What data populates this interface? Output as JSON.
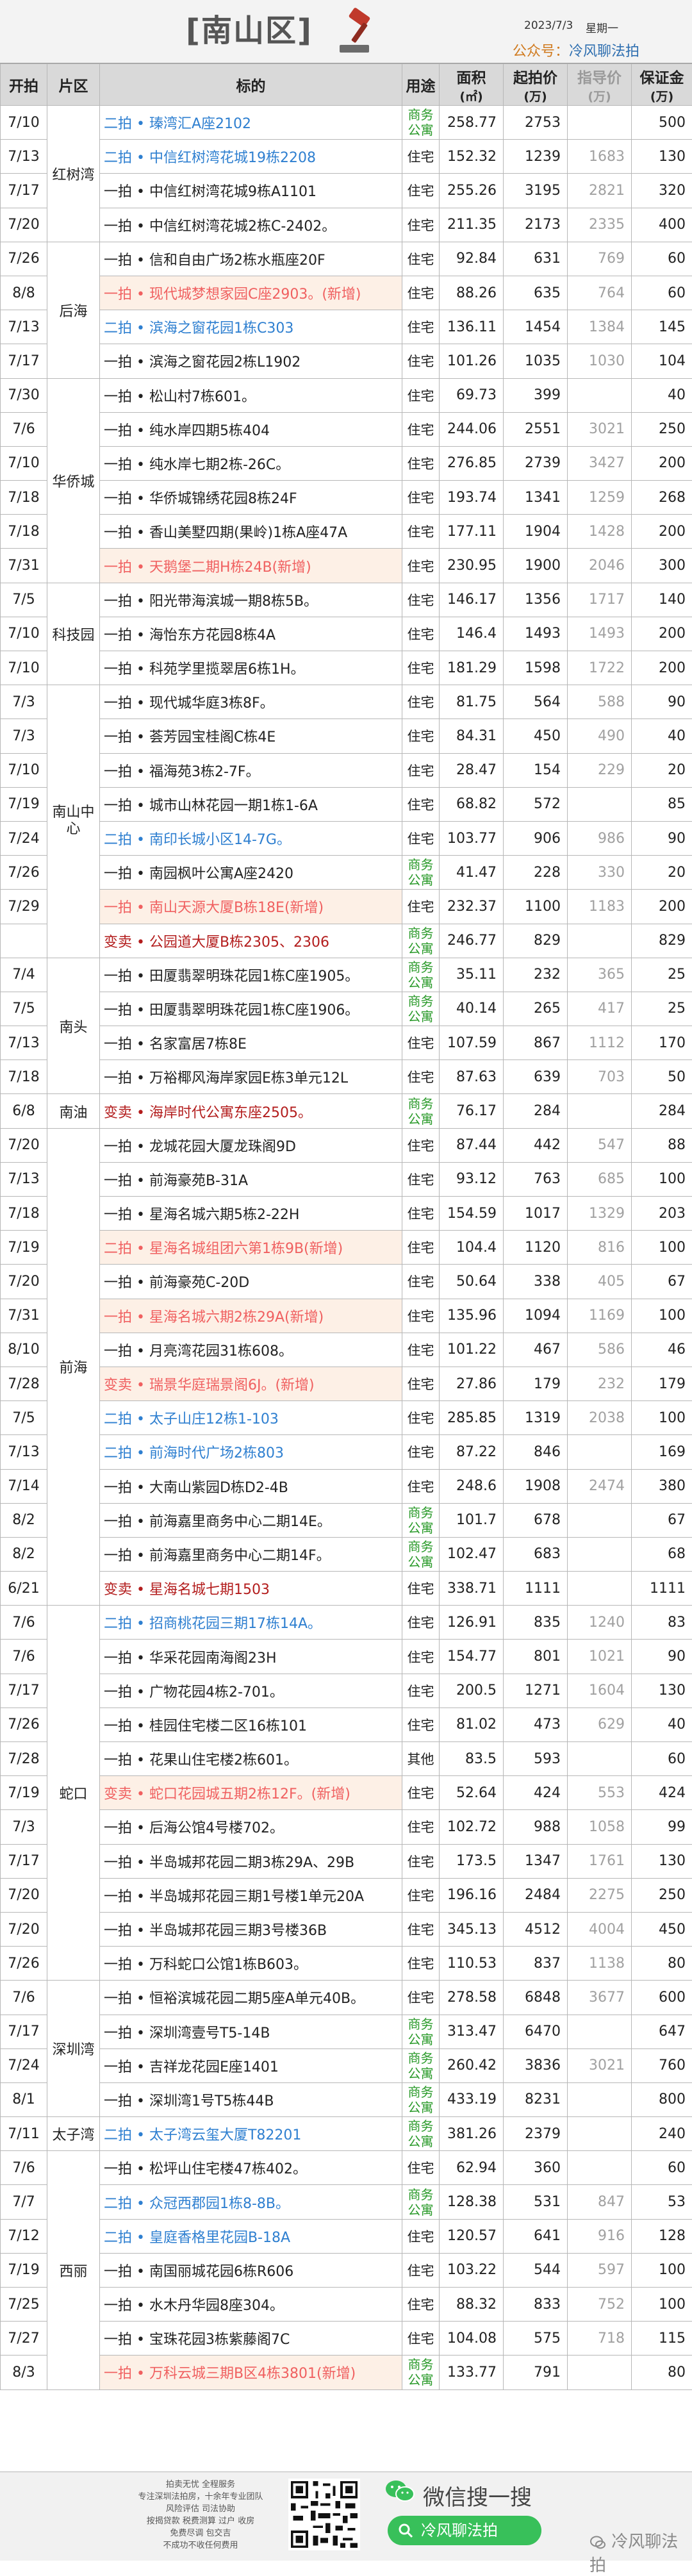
{
  "header": {
    "title": "[南山区]",
    "date": "2023/7/3",
    "weekday": "星期一",
    "publisher_label": "公众号：",
    "publisher_name": "冷风聊法拍"
  },
  "columns": {
    "date": "开拍",
    "area": "片区",
    "target": "标的",
    "usage": "用途",
    "size_top": "面积",
    "size_unit": "(㎡)",
    "start_top": "起拍价",
    "start_unit": "(万)",
    "ref_top": "指导价",
    "ref_unit": "(万)",
    "deposit_top": "保证金",
    "deposit_unit": "(万)"
  },
  "areas": [
    {
      "name": "红树湾",
      "span": 4
    },
    {
      "name": "后海",
      "span": 4
    },
    {
      "name": "华侨城",
      "span": 6
    },
    {
      "name": "科技园",
      "span": 3
    },
    {
      "name": "南山中心",
      "span": 8
    },
    {
      "name": "南头",
      "span": 4
    },
    {
      "name": "南油",
      "span": 1
    },
    {
      "name": "前海",
      "span": 14
    },
    {
      "name": "蛇口",
      "span": 11
    },
    {
      "name": "深圳湾",
      "span": 4
    },
    {
      "name": "太子湾",
      "span": 1
    },
    {
      "name": "西丽",
      "span": 8
    }
  ],
  "rows": [
    {
      "date": "7/10",
      "title": "二拍 • 瑧湾汇A座2102",
      "usage": "商务公寓",
      "area": "258.77",
      "start": "2753",
      "ref": "",
      "deposit": "500",
      "kind": "r"
    },
    {
      "date": "7/13",
      "title": "二拍 • 中信红树湾花城19栋2208",
      "usage": "住宅",
      "area": "152.32",
      "start": "1239",
      "ref": "1683",
      "deposit": "130",
      "kind": "r"
    },
    {
      "date": "7/17",
      "title": "一拍 • 中信红树湾花城9栋A1101",
      "usage": "住宅",
      "area": "255.26",
      "start": "3195",
      "ref": "2821",
      "deposit": "320",
      "kind": ""
    },
    {
      "date": "7/20",
      "title": "一拍 • 中信红树湾花城2栋C-2402。",
      "usage": "住宅",
      "area": "211.35",
      "start": "2173",
      "ref": "2335",
      "deposit": "400",
      "kind": ""
    },
    {
      "date": "7/26",
      "title": "一拍 • 信和自由广场2栋水瓶座20F",
      "usage": "住宅",
      "area": "92.84",
      "start": "631",
      "ref": "769",
      "deposit": "60",
      "kind": ""
    },
    {
      "date": "8/8",
      "title": "一拍 • 现代城梦想家园C座2903。(新增)",
      "usage": "住宅",
      "area": "88.26",
      "start": "635",
      "ref": "764",
      "deposit": "60",
      "kind": "p"
    },
    {
      "date": "7/13",
      "title": "二拍 • 滨海之窗花园1栋C303",
      "usage": "住宅",
      "area": "136.11",
      "start": "1454",
      "ref": "1384",
      "deposit": "145",
      "kind": "r"
    },
    {
      "date": "7/17",
      "title": "一拍 • 滨海之窗花园2栋L1902",
      "usage": "住宅",
      "area": "101.26",
      "start": "1035",
      "ref": "1030",
      "deposit": "104",
      "kind": ""
    },
    {
      "date": "7/30",
      "title": "一拍 • 松山村7栋601。",
      "usage": "住宅",
      "area": "69.73",
      "start": "399",
      "ref": "",
      "deposit": "40",
      "kind": ""
    },
    {
      "date": "7/6",
      "title": "一拍 • 纯水岸四期5栋404",
      "usage": "住宅",
      "area": "244.06",
      "start": "2551",
      "ref": "3021",
      "deposit": "250",
      "kind": ""
    },
    {
      "date": "7/10",
      "title": "一拍 • 纯水岸七期2栋-26C。",
      "usage": "住宅",
      "area": "276.85",
      "start": "2739",
      "ref": "3427",
      "deposit": "200",
      "kind": ""
    },
    {
      "date": "7/18",
      "title": "一拍 • 华侨城锦绣花园8栋24F",
      "usage": "住宅",
      "area": "193.74",
      "start": "1341",
      "ref": "1259",
      "deposit": "268",
      "kind": ""
    },
    {
      "date": "7/18",
      "title": "一拍 • 香山美墅四期(果岭)1栋A座47A",
      "usage": "住宅",
      "area": "177.11",
      "start": "1904",
      "ref": "1428",
      "deposit": "200",
      "kind": ""
    },
    {
      "date": "7/31",
      "title": "一拍 • 天鹅堡二期H栋24B(新增)",
      "usage": "住宅",
      "area": "230.95",
      "start": "1900",
      "ref": "2046",
      "deposit": "300",
      "kind": "p"
    },
    {
      "date": "7/5",
      "title": "一拍 • 阳光带海滨城一期8栋5B。",
      "usage": "住宅",
      "area": "146.17",
      "start": "1356",
      "ref": "1717",
      "deposit": "140",
      "kind": ""
    },
    {
      "date": "7/10",
      "title": "一拍 • 海怡东方花园8栋4A",
      "usage": "住宅",
      "area": "146.4",
      "start": "1493",
      "ref": "1493",
      "deposit": "200",
      "kind": ""
    },
    {
      "date": "7/10",
      "title": "一拍 • 科苑学里揽翠居6栋1H。",
      "usage": "住宅",
      "area": "181.29",
      "start": "1598",
      "ref": "1722",
      "deposit": "200",
      "kind": ""
    },
    {
      "date": "7/3",
      "title": "一拍 • 现代城华庭3栋8F。",
      "usage": "住宅",
      "area": "81.75",
      "start": "564",
      "ref": "588",
      "deposit": "90",
      "kind": ""
    },
    {
      "date": "7/3",
      "title": "一拍 • 荟芳园宝桂阁C栋4E",
      "usage": "住宅",
      "area": "84.31",
      "start": "450",
      "ref": "490",
      "deposit": "40",
      "kind": ""
    },
    {
      "date": "7/10",
      "title": "一拍 • 福海苑3栋2-7F。",
      "usage": "住宅",
      "area": "28.47",
      "start": "154",
      "ref": "229",
      "deposit": "20",
      "kind": ""
    },
    {
      "date": "7/19",
      "title": "一拍 • 城市山林花园一期1栋1-6A",
      "usage": "住宅",
      "area": "68.82",
      "start": "572",
      "ref": "",
      "deposit": "85",
      "kind": ""
    },
    {
      "date": "7/24",
      "title": "二拍 • 南印长城小区14-7G。",
      "usage": "住宅",
      "area": "103.77",
      "start": "906",
      "ref": "986",
      "deposit": "90",
      "kind": "r"
    },
    {
      "date": "7/26",
      "title": "一拍 • 南园枫叶公寓A座2420",
      "usage": "商务公寓",
      "area": "41.47",
      "start": "228",
      "ref": "330",
      "deposit": "20",
      "kind": ""
    },
    {
      "date": "7/29",
      "title": "一拍 • 南山天源大厦B栋18E(新增)",
      "usage": "住宅",
      "area": "232.37",
      "start": "1100",
      "ref": "1183",
      "deposit": "200",
      "kind": "p"
    },
    {
      "date": "",
      "title": "变卖 • 公园道大厦B栋2305、2306",
      "usage": "商务公寓",
      "area": "246.77",
      "start": "829",
      "ref": "",
      "deposit": "829",
      "kind": "s"
    },
    {
      "date": "7/4",
      "title": "一拍 • 田厦翡翠明珠花园1栋C座1905。",
      "usage": "商务公寓",
      "area": "35.11",
      "start": "232",
      "ref": "365",
      "deposit": "25",
      "kind": ""
    },
    {
      "date": "7/5",
      "title": "一拍 • 田厦翡翠明珠花园1栋C座1906。",
      "usage": "商务公寓",
      "area": "40.14",
      "start": "265",
      "ref": "417",
      "deposit": "25",
      "kind": ""
    },
    {
      "date": "7/13",
      "title": "一拍 • 名家富居7栋8E",
      "usage": "住宅",
      "area": "107.59",
      "start": "867",
      "ref": "1112",
      "deposit": "170",
      "kind": ""
    },
    {
      "date": "7/18",
      "title": "一拍 • 万裕椰风海岸家园E栋3单元12L",
      "usage": "住宅",
      "area": "87.63",
      "start": "639",
      "ref": "703",
      "deposit": "50",
      "kind": ""
    },
    {
      "date": "6/8",
      "title": "变卖 • 海岸时代公寓东座2505。",
      "usage": "商务公寓",
      "area": "76.17",
      "start": "284",
      "ref": "",
      "deposit": "284",
      "kind": "s"
    },
    {
      "date": "7/20",
      "title": "一拍 • 龙城花园大厦龙珠阁9D",
      "usage": "住宅",
      "area": "87.44",
      "start": "442",
      "ref": "547",
      "deposit": "88",
      "kind": ""
    },
    {
      "date": "7/13",
      "title": "一拍 • 前海豪苑B-31A",
      "usage": "住宅",
      "area": "93.12",
      "start": "763",
      "ref": "685",
      "deposit": "100",
      "kind": ""
    },
    {
      "date": "7/18",
      "title": "一拍 • 星海名城六期5栋2-22H",
      "usage": "住宅",
      "area": "154.59",
      "start": "1017",
      "ref": "1329",
      "deposit": "203",
      "kind": ""
    },
    {
      "date": "7/19",
      "title": "二拍 • 星海名城组团六第1栋9B(新增)",
      "usage": "住宅",
      "area": "104.4",
      "start": "1120",
      "ref": "816",
      "deposit": "100",
      "kind": "p"
    },
    {
      "date": "7/20",
      "title": "一拍 • 前海豪苑C-20D",
      "usage": "住宅",
      "area": "50.64",
      "start": "338",
      "ref": "405",
      "deposit": "67",
      "kind": ""
    },
    {
      "date": "7/31",
      "title": "一拍 • 星海名城六期2栋29A(新增)",
      "usage": "住宅",
      "area": "135.96",
      "start": "1094",
      "ref": "1169",
      "deposit": "100",
      "kind": "p"
    },
    {
      "date": "8/10",
      "title": "一拍 • 月亮湾花园31栋608。",
      "usage": "住宅",
      "area": "101.22",
      "start": "467",
      "ref": "586",
      "deposit": "46",
      "kind": ""
    },
    {
      "date": "7/28",
      "title": "变卖 • 瑞景华庭瑞景阁6J。(新增)",
      "usage": "住宅",
      "area": "27.86",
      "start": "179",
      "ref": "232",
      "deposit": "179",
      "kind": "p"
    },
    {
      "date": "7/5",
      "title": "二拍 • 太子山庄12栋1-103",
      "usage": "住宅",
      "area": "285.85",
      "start": "1319",
      "ref": "2038",
      "deposit": "100",
      "kind": "r"
    },
    {
      "date": "7/13",
      "title": "二拍 • 前海时代广场2栋803",
      "usage": "住宅",
      "area": "87.22",
      "start": "846",
      "ref": "",
      "deposit": "169",
      "kind": "r"
    },
    {
      "date": "7/14",
      "title": "一拍 • 大南山紫园D栋D2-4B",
      "usage": "住宅",
      "area": "248.6",
      "start": "1908",
      "ref": "2474",
      "deposit": "380",
      "kind": ""
    },
    {
      "date": "8/2",
      "title": "一拍 • 前海嘉里商务中心二期14E。",
      "usage": "商务公寓",
      "area": "101.7",
      "start": "678",
      "ref": "",
      "deposit": "67",
      "kind": ""
    },
    {
      "date": "8/2",
      "title": "一拍 • 前海嘉里商务中心二期14F。",
      "usage": "商务公寓",
      "area": "102.47",
      "start": "683",
      "ref": "",
      "deposit": "68",
      "kind": ""
    },
    {
      "date": "6/21",
      "title": "变卖 • 星海名城七期1503",
      "usage": "住宅",
      "area": "338.71",
      "start": "1111",
      "ref": "",
      "deposit": "1111",
      "kind": "s"
    },
    {
      "date": "7/6",
      "title": "二拍 • 招商桃花园三期17栋14A。",
      "usage": "住宅",
      "area": "126.91",
      "start": "835",
      "ref": "1240",
      "deposit": "83",
      "kind": "r"
    },
    {
      "date": "7/6",
      "title": "一拍 • 华采花园南海阁23H",
      "usage": "住宅",
      "area": "154.77",
      "start": "801",
      "ref": "1021",
      "deposit": "90",
      "kind": ""
    },
    {
      "date": "7/17",
      "title": "一拍 • 广物花园4栋2-701。",
      "usage": "住宅",
      "area": "200.5",
      "start": "1271",
      "ref": "1604",
      "deposit": "130",
      "kind": ""
    },
    {
      "date": "7/26",
      "title": "一拍 • 桂园住宅楼二区16栋101",
      "usage": "住宅",
      "area": "81.02",
      "start": "473",
      "ref": "629",
      "deposit": "40",
      "kind": ""
    },
    {
      "date": "7/28",
      "title": "一拍 • 花果山住宅楼2栋601。",
      "usage": "其他",
      "area": "83.5",
      "start": "593",
      "ref": "",
      "deposit": "60",
      "kind": ""
    },
    {
      "date": "7/19",
      "title": "变卖 • 蛇口花园城五期2栋12F。(新增)",
      "usage": "住宅",
      "area": "52.64",
      "start": "424",
      "ref": "553",
      "deposit": "424",
      "kind": "p"
    },
    {
      "date": "7/3",
      "title": "一拍 • 后海公馆4号楼702。",
      "usage": "住宅",
      "area": "102.72",
      "start": "988",
      "ref": "1058",
      "deposit": "99",
      "kind": ""
    },
    {
      "date": "7/17",
      "title": "一拍 • 半岛城邦花园二期3栋29A、29B",
      "usage": "住宅",
      "area": "173.5",
      "start": "1347",
      "ref": "1761",
      "deposit": "130",
      "kind": ""
    },
    {
      "date": "7/20",
      "title": "一拍 • 半岛城邦花园三期1号楼1单元20A",
      "usage": "住宅",
      "area": "196.16",
      "start": "2484",
      "ref": "2275",
      "deposit": "250",
      "kind": ""
    },
    {
      "date": "7/20",
      "title": "一拍 • 半岛城邦花园三期3号楼36B",
      "usage": "住宅",
      "area": "345.13",
      "start": "4512",
      "ref": "4004",
      "deposit": "450",
      "kind": ""
    },
    {
      "date": "7/26",
      "title": "一拍 • 万科蛇口公馆1栋B603。",
      "usage": "住宅",
      "area": "110.53",
      "start": "837",
      "ref": "1138",
      "deposit": "80",
      "kind": ""
    },
    {
      "date": "7/6",
      "title": "一拍 • 恒裕滨城花园二期5座A单元40B。",
      "usage": "住宅",
      "area": "278.58",
      "start": "6848",
      "ref": "3677",
      "deposit": "600",
      "kind": ""
    },
    {
      "date": "7/17",
      "title": "一拍 • 深圳湾壹号T5-14B",
      "usage": "商务公寓",
      "area": "313.47",
      "start": "6470",
      "ref": "",
      "deposit": "647",
      "kind": ""
    },
    {
      "date": "7/24",
      "title": "一拍 • 吉祥龙花园E座1401",
      "usage": "商务公寓",
      "area": "260.42",
      "start": "3836",
      "ref": "3021",
      "deposit": "760",
      "kind": ""
    },
    {
      "date": "8/1",
      "title": "一拍 • 深圳湾1号T5栋44B",
      "usage": "商务公寓",
      "area": "433.19",
      "start": "8231",
      "ref": "",
      "deposit": "800",
      "kind": ""
    },
    {
      "date": "7/11",
      "title": "二拍 • 太子湾云玺大厦T82201",
      "usage": "商务公寓",
      "area": "381.26",
      "start": "2379",
      "ref": "",
      "deposit": "240",
      "kind": "r"
    },
    {
      "date": "7/6",
      "title": "一拍 • 松坪山住宅楼47栋402。",
      "usage": "住宅",
      "area": "62.94",
      "start": "360",
      "ref": "",
      "deposit": "60",
      "kind": ""
    },
    {
      "date": "7/7",
      "title": "二拍 • 众冠西郡园1栋8-8B。",
      "usage": "商务公寓",
      "area": "128.38",
      "start": "531",
      "ref": "847",
      "deposit": "53",
      "kind": "r"
    },
    {
      "date": "7/12",
      "title": "二拍 • 皇庭香格里花园B-18A",
      "usage": "住宅",
      "area": "120.57",
      "start": "641",
      "ref": "916",
      "deposit": "128",
      "kind": "r"
    },
    {
      "date": "7/19",
      "title": "一拍 • 南国丽城花园6栋R606",
      "usage": "住宅",
      "area": "103.22",
      "start": "544",
      "ref": "597",
      "deposit": "100",
      "kind": ""
    },
    {
      "date": "7/25",
      "title": "一拍 • 水木丹华园8座304。",
      "usage": "住宅",
      "area": "88.32",
      "start": "833",
      "ref": "752",
      "deposit": "100",
      "kind": ""
    },
    {
      "date": "7/27",
      "title": "一拍 • 宝珠花园3栋紫藤阁7C",
      "usage": "住宅",
      "area": "104.08",
      "start": "575",
      "ref": "718",
      "deposit": "115",
      "kind": ""
    },
    {
      "date": "8/3",
      "title": "一拍 • 万科云城三期B区4栋3801(新增)",
      "usage": "商务公寓",
      "area": "133.77",
      "start": "791",
      "ref": "",
      "deposit": "80",
      "kind": "p"
    }
  ],
  "footer": {
    "slogan_lines": [
      "拍卖无忧 全程服务",
      "专注深圳法拍房，十余年专业团队",
      "风险评估 司法协助",
      "按揭贷款 税费测算 过户 收房",
      "免费尽调 包交吉",
      "不成功不收任何费用"
    ],
    "wechat_search_text": "微信搜一搜",
    "wechat_button_label": "冷风聊法拍",
    "watermark": "冷风聊法拍"
  },
  "colors": {
    "second_auction": "#2e7fd0",
    "new_listing": "#f06060",
    "sale_by_discount": "#b31d1d",
    "commercial_usage": "#2a9a2a",
    "reference_price": "#a0a0a0"
  }
}
